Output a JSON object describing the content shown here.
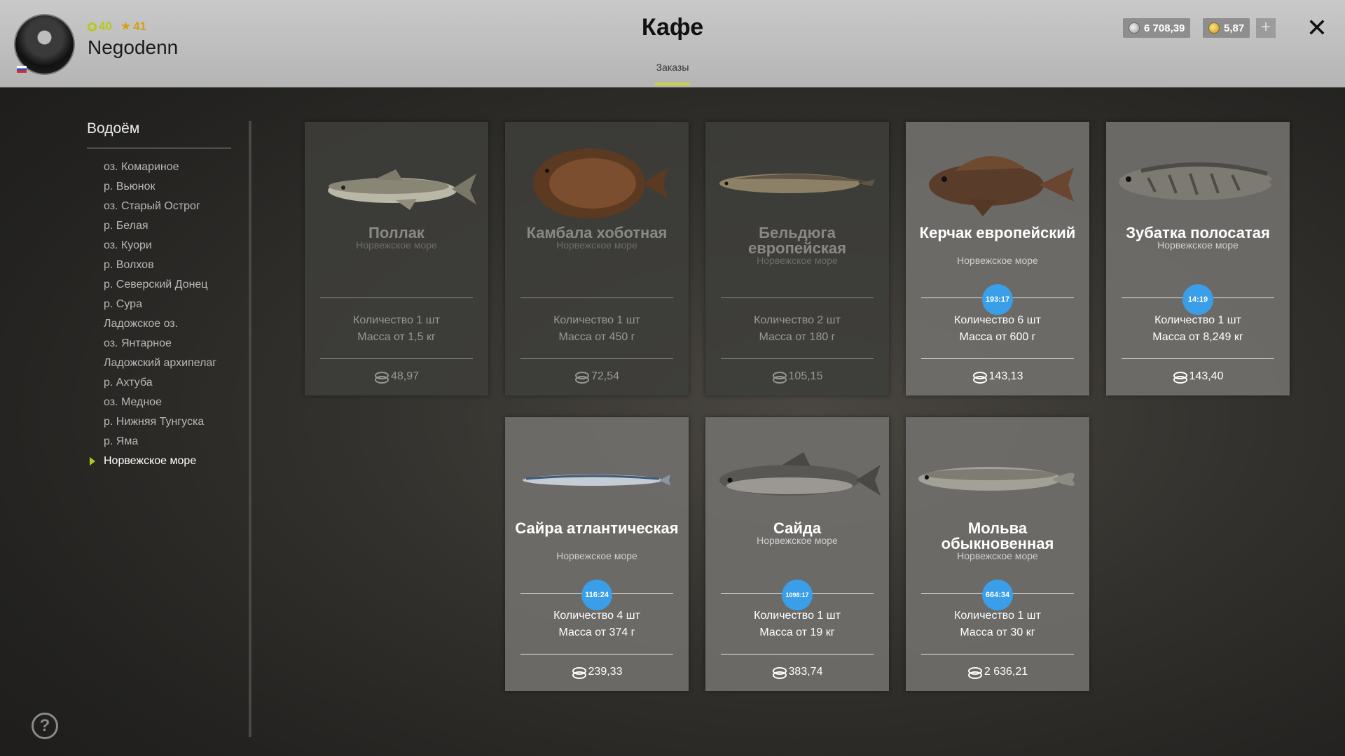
{
  "header": {
    "title": "Кафе",
    "level": "40",
    "rank": "41",
    "username": "Negodenn",
    "tab": "Заказы",
    "silver": "6 708,39",
    "gold": "5,87"
  },
  "sidebar": {
    "title": "Водоём",
    "items": [
      "оз. Комариное",
      "р. Вьюнок",
      "оз. Старый Острог",
      "р. Белая",
      "оз. Куори",
      "р. Волхов",
      "р. Северский Донец",
      "р. Сура",
      "Ладожское оз.",
      "оз. Янтарное",
      "Ладожский архипелаг",
      "р. Ахтуба",
      "оз. Медное",
      "р. Нижняя Тунгуска",
      "р. Яма",
      "Норвежское море"
    ],
    "active": "Норвежское море"
  },
  "cards": [
    {
      "name": "Поллак",
      "region": "Норвежское море",
      "qty": "Количество 1 шт",
      "mass": "Масса от 1,5 кг",
      "price": "48,97",
      "timer": ""
    },
    {
      "name": "Камбала хоботная",
      "region": "Норвежское море",
      "qty": "Количество 1 шт",
      "mass": "Масса от 450 г",
      "price": "72,54",
      "timer": ""
    },
    {
      "name": "Бельдюга европейская",
      "region": "Норвежское море",
      "qty": "Количество 2 шт",
      "mass": "Масса от 180 г",
      "price": "105,15",
      "timer": ""
    },
    {
      "name": "Керчак европейский",
      "region": "Норвежское море",
      "qty": "Количество 6 шт",
      "mass": "Масса от 600 г",
      "price": "143,13",
      "timer": "193:17"
    },
    {
      "name": "Зубатка полосатая",
      "region": "Норвежское море",
      "qty": "Количество 1 шт",
      "mass": "Масса от 8,249 кг",
      "price": "143,40",
      "timer": "14:19"
    },
    {
      "name": "Сайра атлантическая",
      "region": "Норвежское море",
      "qty": "Количество 4 шт",
      "mass": "Масса от 374 г",
      "price": "239,33",
      "timer": "116:24"
    },
    {
      "name": "Сайда",
      "region": "Норвежское море",
      "qty": "Количество 1 шт",
      "mass": "Масса от 19 кг",
      "price": "383,74",
      "timer": "1098:17"
    },
    {
      "name": "Мольва обыкновенная",
      "region": "Норвежское море",
      "qty": "Количество 1 шт",
      "mass": "Масса от 30 кг",
      "price": "2 636,21",
      "timer": "664:34"
    }
  ],
  "icons": {
    "level": "ring-icon",
    "rank": "star-icon",
    "currency_silver": "silver-coin-icon",
    "currency_gold": "gold-coin-icon",
    "price": "coin-stack-icon",
    "close": "close-icon",
    "add": "plus-icon",
    "help": "help-icon"
  },
  "colors": {
    "accent": "#b7c81c",
    "timer": "#3a9ee8",
    "header_bg": "#bdbdbd"
  }
}
